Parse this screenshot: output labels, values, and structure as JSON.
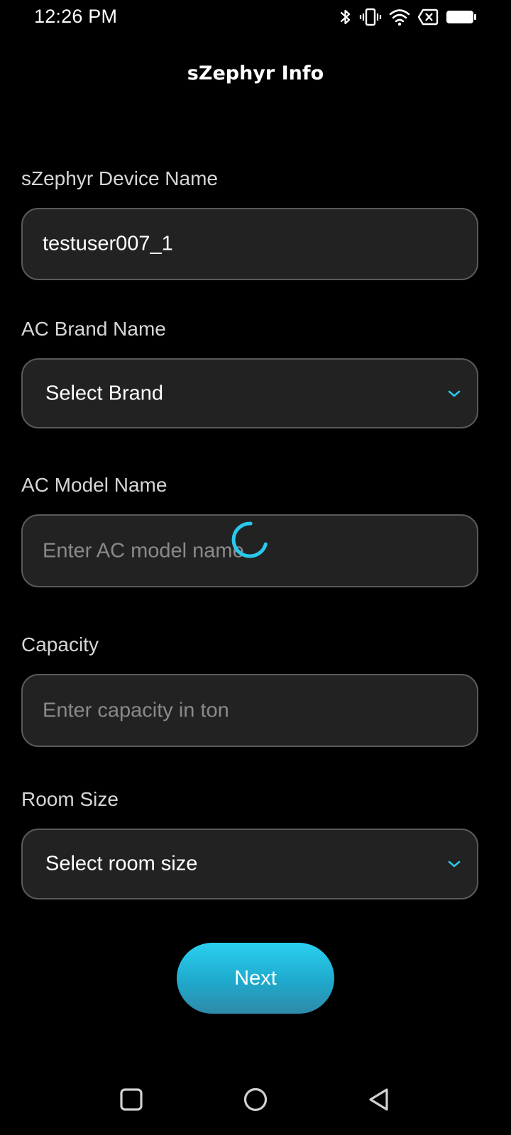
{
  "status_bar": {
    "time": "12:26 PM",
    "icons": [
      "bluetooth-icon",
      "vibrate-icon",
      "wifi-icon",
      "no-sim-icon",
      "battery-icon"
    ]
  },
  "header": {
    "title": "sZephyr Info"
  },
  "form": {
    "device_name": {
      "label": "sZephyr Device Name",
      "value": "testuser007_1"
    },
    "brand": {
      "label": "AC Brand Name",
      "selected": "Select Brand"
    },
    "model": {
      "label": "AC Model Name",
      "placeholder": "Enter AC model name"
    },
    "capacity": {
      "label": "Capacity",
      "placeholder": "Enter capacity in ton"
    },
    "room_size": {
      "label": "Room Size",
      "selected": "Select room size"
    }
  },
  "actions": {
    "next_label": "Next"
  },
  "nav": {
    "icons": [
      "recents-square-icon",
      "home-circle-icon",
      "back-triangle-icon"
    ]
  },
  "colors": {
    "background": "#000000",
    "field_bg": "#222222",
    "field_border": "#5a5a5a",
    "accent": "#29c8ec",
    "label": "#d6d6d6",
    "placeholder": "#8a8a8a"
  },
  "loading": true
}
